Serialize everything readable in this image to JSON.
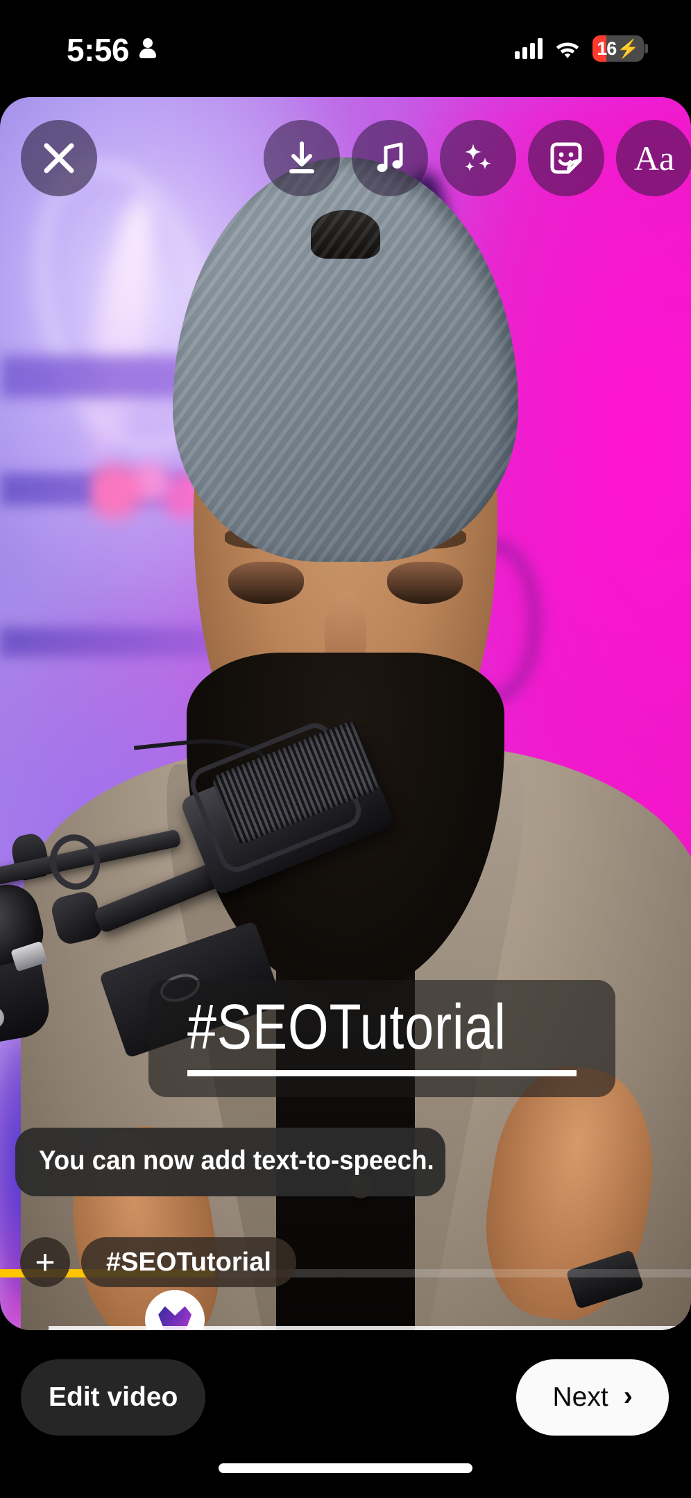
{
  "status_bar": {
    "time": "5:56",
    "person_icon": "person-icon",
    "signal_icon": "cellular-signal-icon",
    "wifi_icon": "wifi-icon",
    "battery_level": "16",
    "battery_charging_icon": "lightning-bolt-icon",
    "battery_color": "#ff3b30"
  },
  "toolbar": {
    "close_icon": "close-x-icon",
    "download_icon": "download-icon",
    "music_icon": "music-note-icon",
    "effects_icon": "sparkles-icon",
    "sticker_icon": "sticker-smiley-icon",
    "text_label": "Aa"
  },
  "overlays": {
    "hashtag_sticker": "#SEOTutorial",
    "tooltip_text": "You can now add text-to-speech.",
    "tag_plus_label": "+",
    "tag_pill_label": "#SEOTutorial",
    "timeline_played_color": "#ffc400",
    "timeline_played_percent": 31
  },
  "bottom_bar": {
    "edit_label": "Edit video",
    "next_label": "Next",
    "next_chevron": "›"
  },
  "colors": {
    "background": "#000000",
    "toolbar_button_bg": "rgba(38,22,52,0.52)",
    "sticker_bg": "rgba(26,26,26,0.62)",
    "tooltip_bg": "rgba(44,44,44,0.95)",
    "next_button_bg": "#fafafa",
    "edit_button_bg": "#262626",
    "accent_magenta": "#f713cf",
    "accent_purple": "#9d8ce8"
  }
}
